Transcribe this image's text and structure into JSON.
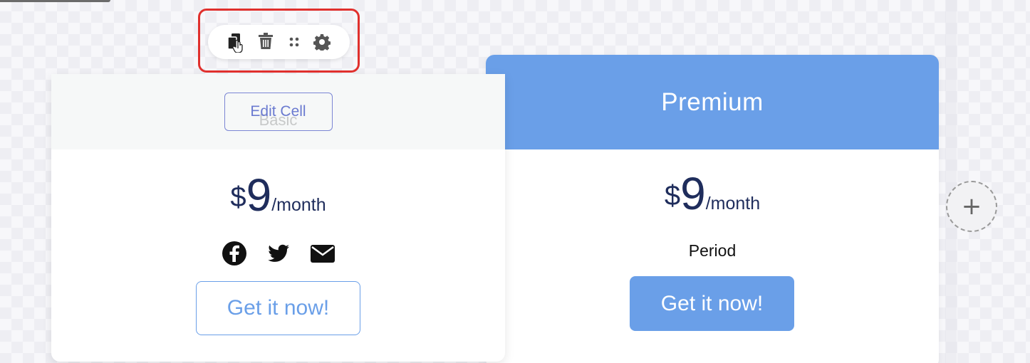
{
  "toolbar": {
    "icons": [
      "copy-icon",
      "trash-icon",
      "drag-handle-icon",
      "gear-icon"
    ]
  },
  "basic_card": {
    "edit_label": "Edit Cell",
    "ghost_title": "Basic",
    "currency": "$",
    "amount": "9",
    "period": "/month",
    "social_icons": [
      "facebook-icon",
      "twitter-icon",
      "envelope-icon"
    ],
    "cta_label": "Get it now!"
  },
  "premium_card": {
    "title": "Premium",
    "currency": "$",
    "amount": "9",
    "period": "/month",
    "period_label": "Period",
    "cta_label": "Get it now!"
  },
  "add_column": {
    "label": "+"
  },
  "colors": {
    "accent": "#6a9fe8",
    "price_text": "#1f2d5c",
    "highlight": "#e0302d"
  }
}
